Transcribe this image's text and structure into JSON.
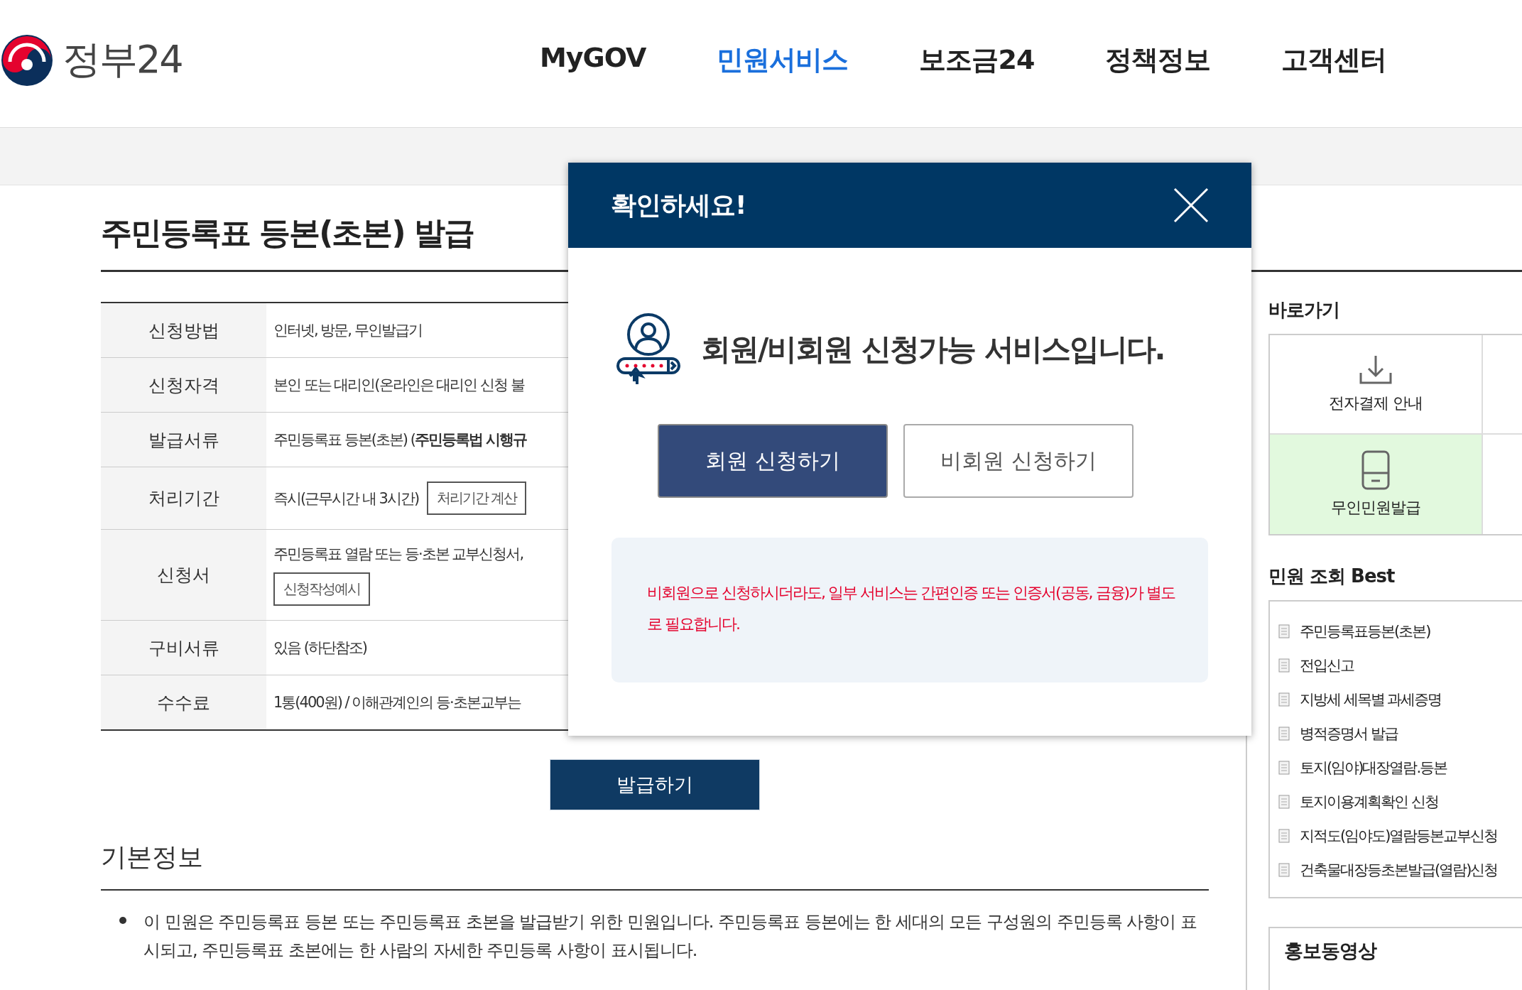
{
  "header": {
    "logo": "정부24",
    "nav": [
      {
        "label": "MyGOV",
        "selected": false
      },
      {
        "label": "민원서비스",
        "selected": true
      },
      {
        "label": "보조금24",
        "selected": false
      },
      {
        "label": "정책정보",
        "selected": false
      },
      {
        "label": "고객센터",
        "selected": false
      }
    ]
  },
  "page": {
    "title": "주민등록표 등본(초본) 발급",
    "table": [
      {
        "kind": "text",
        "label": "신청방법",
        "value": "인터넷, 방문, 무인발급기"
      },
      {
        "kind": "text",
        "label": "신청자격",
        "value": "본인 또는 대리인(온라인은 대리인 신청 불"
      },
      {
        "kind": "text",
        "label": "발급서류",
        "value": "주민등록표 등본(초본) (**주민등록법 시행규**"
      },
      {
        "kind": "inline-button",
        "label": "처리기간",
        "value": "즉시(근무시간 내 3시간)",
        "button": "처리기간 계산"
      },
      {
        "kind": "stacked-button",
        "label": "신청서",
        "value": "주민등록표 열람 또는 등·초본 교부신청서,",
        "button": "신청작성예시"
      },
      {
        "kind": "text",
        "label": "구비서류",
        "value": "있음 (하단참조)"
      },
      {
        "kind": "text",
        "label": "수수료",
        "value": "1통(400원) / 이해관계인의 등·초본교부는"
      }
    ],
    "issue_button": "발급하기",
    "section_title": "기본정보",
    "bullets": [
      "이 민원은 주민등록표 등본 또는 주민등록표 초본을 발급받기 위한 민원입니다. 주민등록표 등본에는 한 세대의 모든 구성원의 주민등록 사항이 표시되고, 주민등록표 초본에는 한 사람의 자세한 주민등록 사항이 표시됩니다."
    ]
  },
  "sidebar": {
    "shortcuts_title": "바로가기",
    "shortcuts": [
      {
        "kind": "download",
        "label": "전자결제 안내",
        "highlighted": false
      },
      {
        "kind": "kiosk",
        "label": "무인민원발급",
        "highlighted": true
      }
    ],
    "best_title": "민원 조회 Best",
    "best_items": [
      "주민등록표등본(초본)",
      "전입신고",
      "지방세 세목별 과세증명",
      "병적증명서 발급",
      "토지(임야)대장열람.등본",
      "토지이용계획확인 신청",
      "지적도(임야도)열람등본교부신청",
      "건축물대장등초본발급(열람)신청"
    ],
    "video_title": "홍보동영상"
  },
  "dialog": {
    "title": "확인하세요!",
    "message": "회원/비회원 신청가능 서비스입니다.",
    "buttons": [
      {
        "kind": "primary",
        "label": "회원 신청하기"
      },
      {
        "kind": "secondary",
        "label": "비회원 신청하기"
      }
    ],
    "notice": "비회원으로 신청하시더라도, 일부 서비스는 간편인증 또는 인증서(공동, 금융)가 별도로 필요합니다."
  }
}
